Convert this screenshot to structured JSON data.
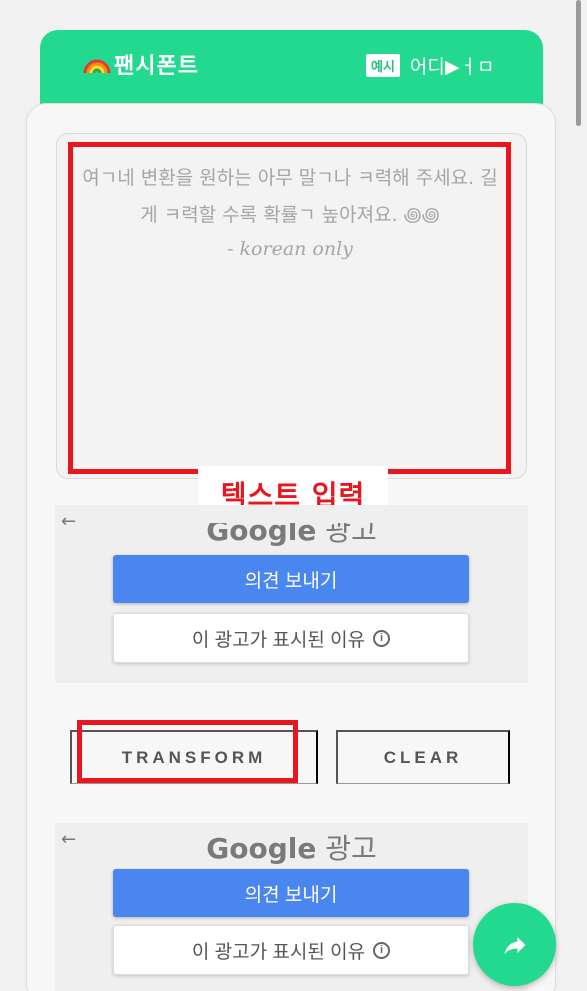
{
  "header": {
    "logo_text": "팬시폰트",
    "example_badge": "예시",
    "where_label": "어디▶ㅓㅁ"
  },
  "editor": {
    "placeholder_line": "여ㄱ네 변환을 원하는 아무 말ㄱ나 ㅋ력해 주세요. 길게 ㅋ력할 수록 확률ㄱ 높아져요. ꩜꩜",
    "placeholder_note": "- korean only"
  },
  "annotation": {
    "text_input_label": "텍스트 입력"
  },
  "ads": [
    {
      "title_brand": "Google",
      "title_suffix": "광고",
      "feedback_label": "의견 보내기",
      "why_label": "이 광고가 표시된 이유"
    },
    {
      "title_brand": "Google",
      "title_suffix": "광고",
      "feedback_label": "의견 보내기",
      "why_label": "이 광고가 표시된 이유"
    }
  ],
  "actions": {
    "transform_label": "TRANSFORM",
    "clear_label": "CLEAR"
  },
  "colors": {
    "brand_green": "#22d98f",
    "highlight_red": "#e8161e",
    "ad_blue": "#4a86f0"
  },
  "icons": {
    "logo": "rainbow-icon",
    "ad_back": "back-arrow-icon",
    "ad_info": "info-icon",
    "fab": "share-icon"
  }
}
